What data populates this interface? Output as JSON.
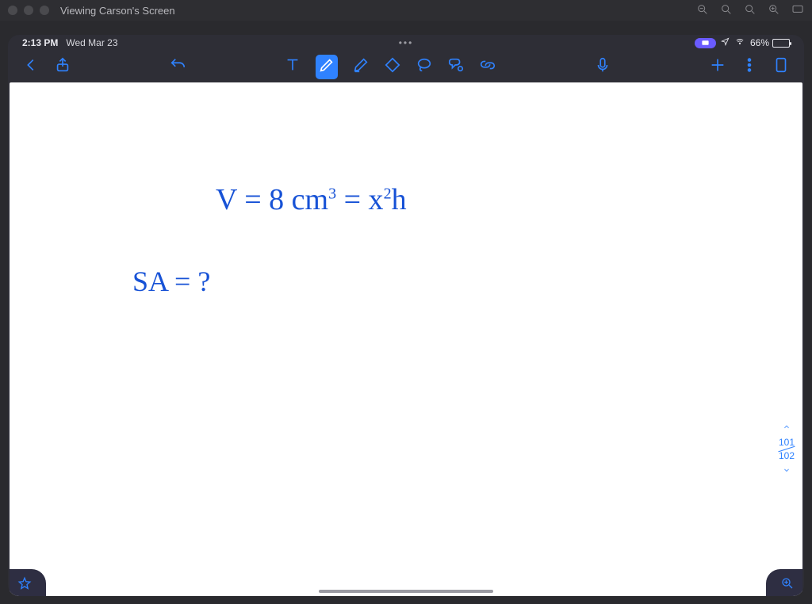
{
  "mac": {
    "title": "Viewing Carson's Screen"
  },
  "ios_status": {
    "time": "2:13 PM",
    "date": "Wed Mar 23",
    "battery_pct": "66%"
  },
  "handwriting": {
    "line1_pre": "V = 8 cm",
    "line1_sup1": "3",
    "line1_mid": " = x",
    "line1_sup2": "2",
    "line1_post": "h",
    "line2": "SA = ?"
  },
  "pager": {
    "current": "101",
    "total": "102"
  },
  "icons": {
    "back": "back-chevron",
    "share": "share",
    "undo": "undo",
    "text": "text-tool",
    "pen": "pen-tool",
    "highlighter": "highlighter-tool",
    "eraser": "eraser-tool",
    "lasso": "lasso-tool",
    "shapes": "shapes-tool",
    "link": "attachment-tool",
    "mic": "microphone",
    "add": "add",
    "more": "more",
    "pages": "pages",
    "star": "favorite",
    "zoom": "zoom-in"
  }
}
